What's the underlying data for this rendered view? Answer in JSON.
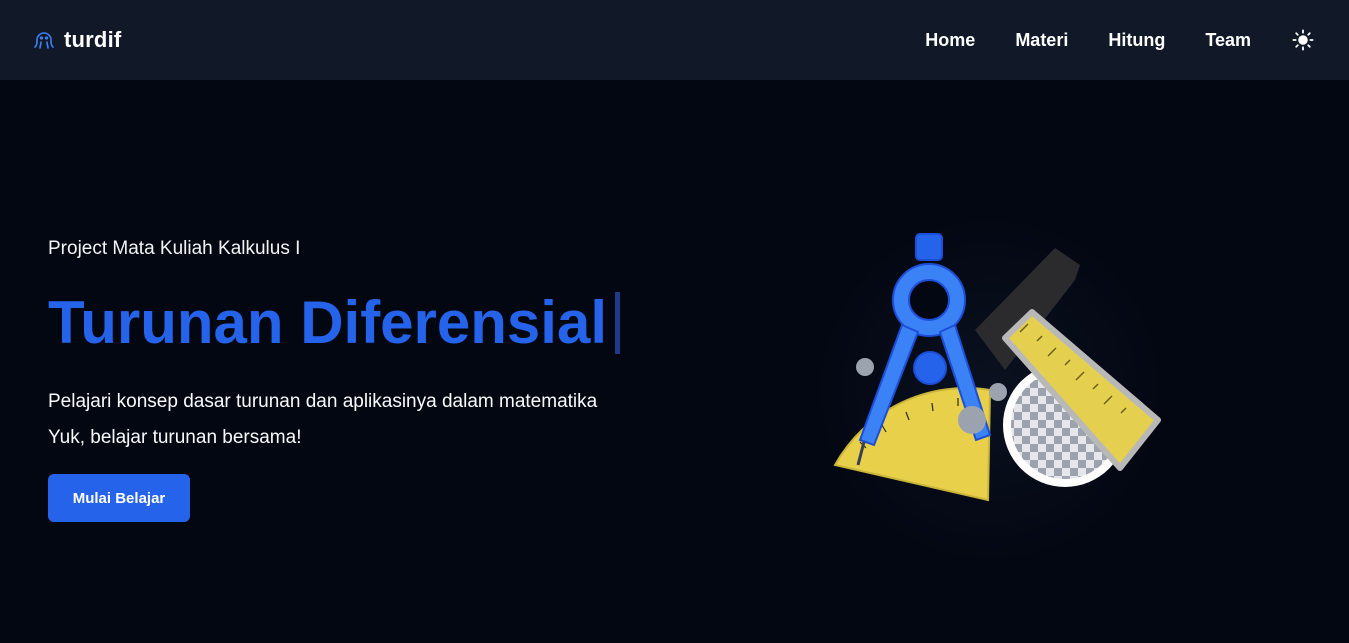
{
  "brand": {
    "name": "turdif",
    "icon": "octopus-icon"
  },
  "nav": {
    "items": [
      {
        "label": "Home"
      },
      {
        "label": "Materi"
      },
      {
        "label": "Hitung"
      },
      {
        "label": "Team"
      }
    ],
    "theme_toggle_icon": "sun-icon"
  },
  "hero": {
    "subtitle": "Project Mata Kuliah Kalkulus I",
    "headline": "Turunan Diferensial",
    "description_lines": [
      "Pelajari konsep dasar turunan dan aplikasinya dalam matematika",
      "Yuk, belajar turunan bersama!"
    ],
    "cta_label": "Mulai Belajar"
  },
  "illustration": {
    "icon": "geometry-tools-icon"
  },
  "colors": {
    "background": "#030712",
    "navbar": "#111827",
    "accent": "#2563eb",
    "cursor": "#1e3a8a",
    "text": "#ffffff"
  }
}
